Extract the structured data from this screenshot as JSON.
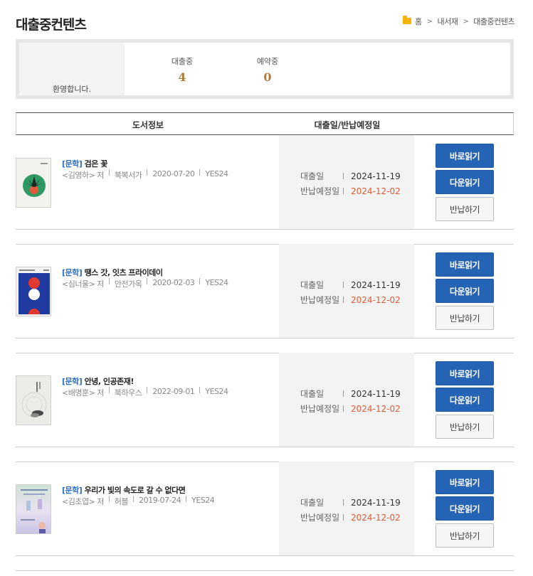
{
  "page": {
    "title": "대출중컨텐츠"
  },
  "breadcrumb": {
    "items": [
      "홈",
      "내서재",
      "대출중컨텐츠"
    ]
  },
  "summary": {
    "welcome": "환영합니다.",
    "stats": [
      {
        "label": "대출중",
        "value": "4"
      },
      {
        "label": "예약중",
        "value": "0"
      }
    ]
  },
  "table": {
    "headers": {
      "book_info": "도서정보",
      "dates": "대출일/반납예정일"
    },
    "date_labels": {
      "loan": "대출일",
      "due": "반납예정일"
    },
    "buttons": {
      "read": "바로읽기",
      "download": "다운읽기",
      "return": "반납하기"
    },
    "rows": [
      {
        "category": "[문학]",
        "title": "검은 꽃",
        "author": "<김영하> 저",
        "publisher": "복복서가",
        "pub_date": "2020-07-20",
        "vendor": "YES24",
        "loan_date": "2024-11-19",
        "due_date": "2024-12-02"
      },
      {
        "category": "[문학]",
        "title": "땡스 갓, 잇츠 프라이데이",
        "author": "<심너울> 저",
        "publisher": "안전가옥",
        "pub_date": "2020-02-03",
        "vendor": "YES24",
        "loan_date": "2024-11-19",
        "due_date": "2024-12-02"
      },
      {
        "category": "[문학]",
        "title": "안녕, 인공존재!",
        "author": "<배명훈> 저",
        "publisher": "북하우스",
        "pub_date": "2022-09-01",
        "vendor": "YES24",
        "loan_date": "2024-11-19",
        "due_date": "2024-12-02"
      },
      {
        "category": "[문학]",
        "title": "우리가 빛의 속도로 갈 수 없다면",
        "author": "<김초엽> 저",
        "publisher": "허블",
        "pub_date": "2019-07-24",
        "vendor": "YES24",
        "loan_date": "2024-11-19",
        "due_date": "2024-12-02"
      }
    ]
  },
  "colors": {
    "accent_blue": "#2563b5",
    "category_blue": "#2f6fbd",
    "due_red": "#e05c37",
    "stat_brown": "#b07a3a"
  }
}
